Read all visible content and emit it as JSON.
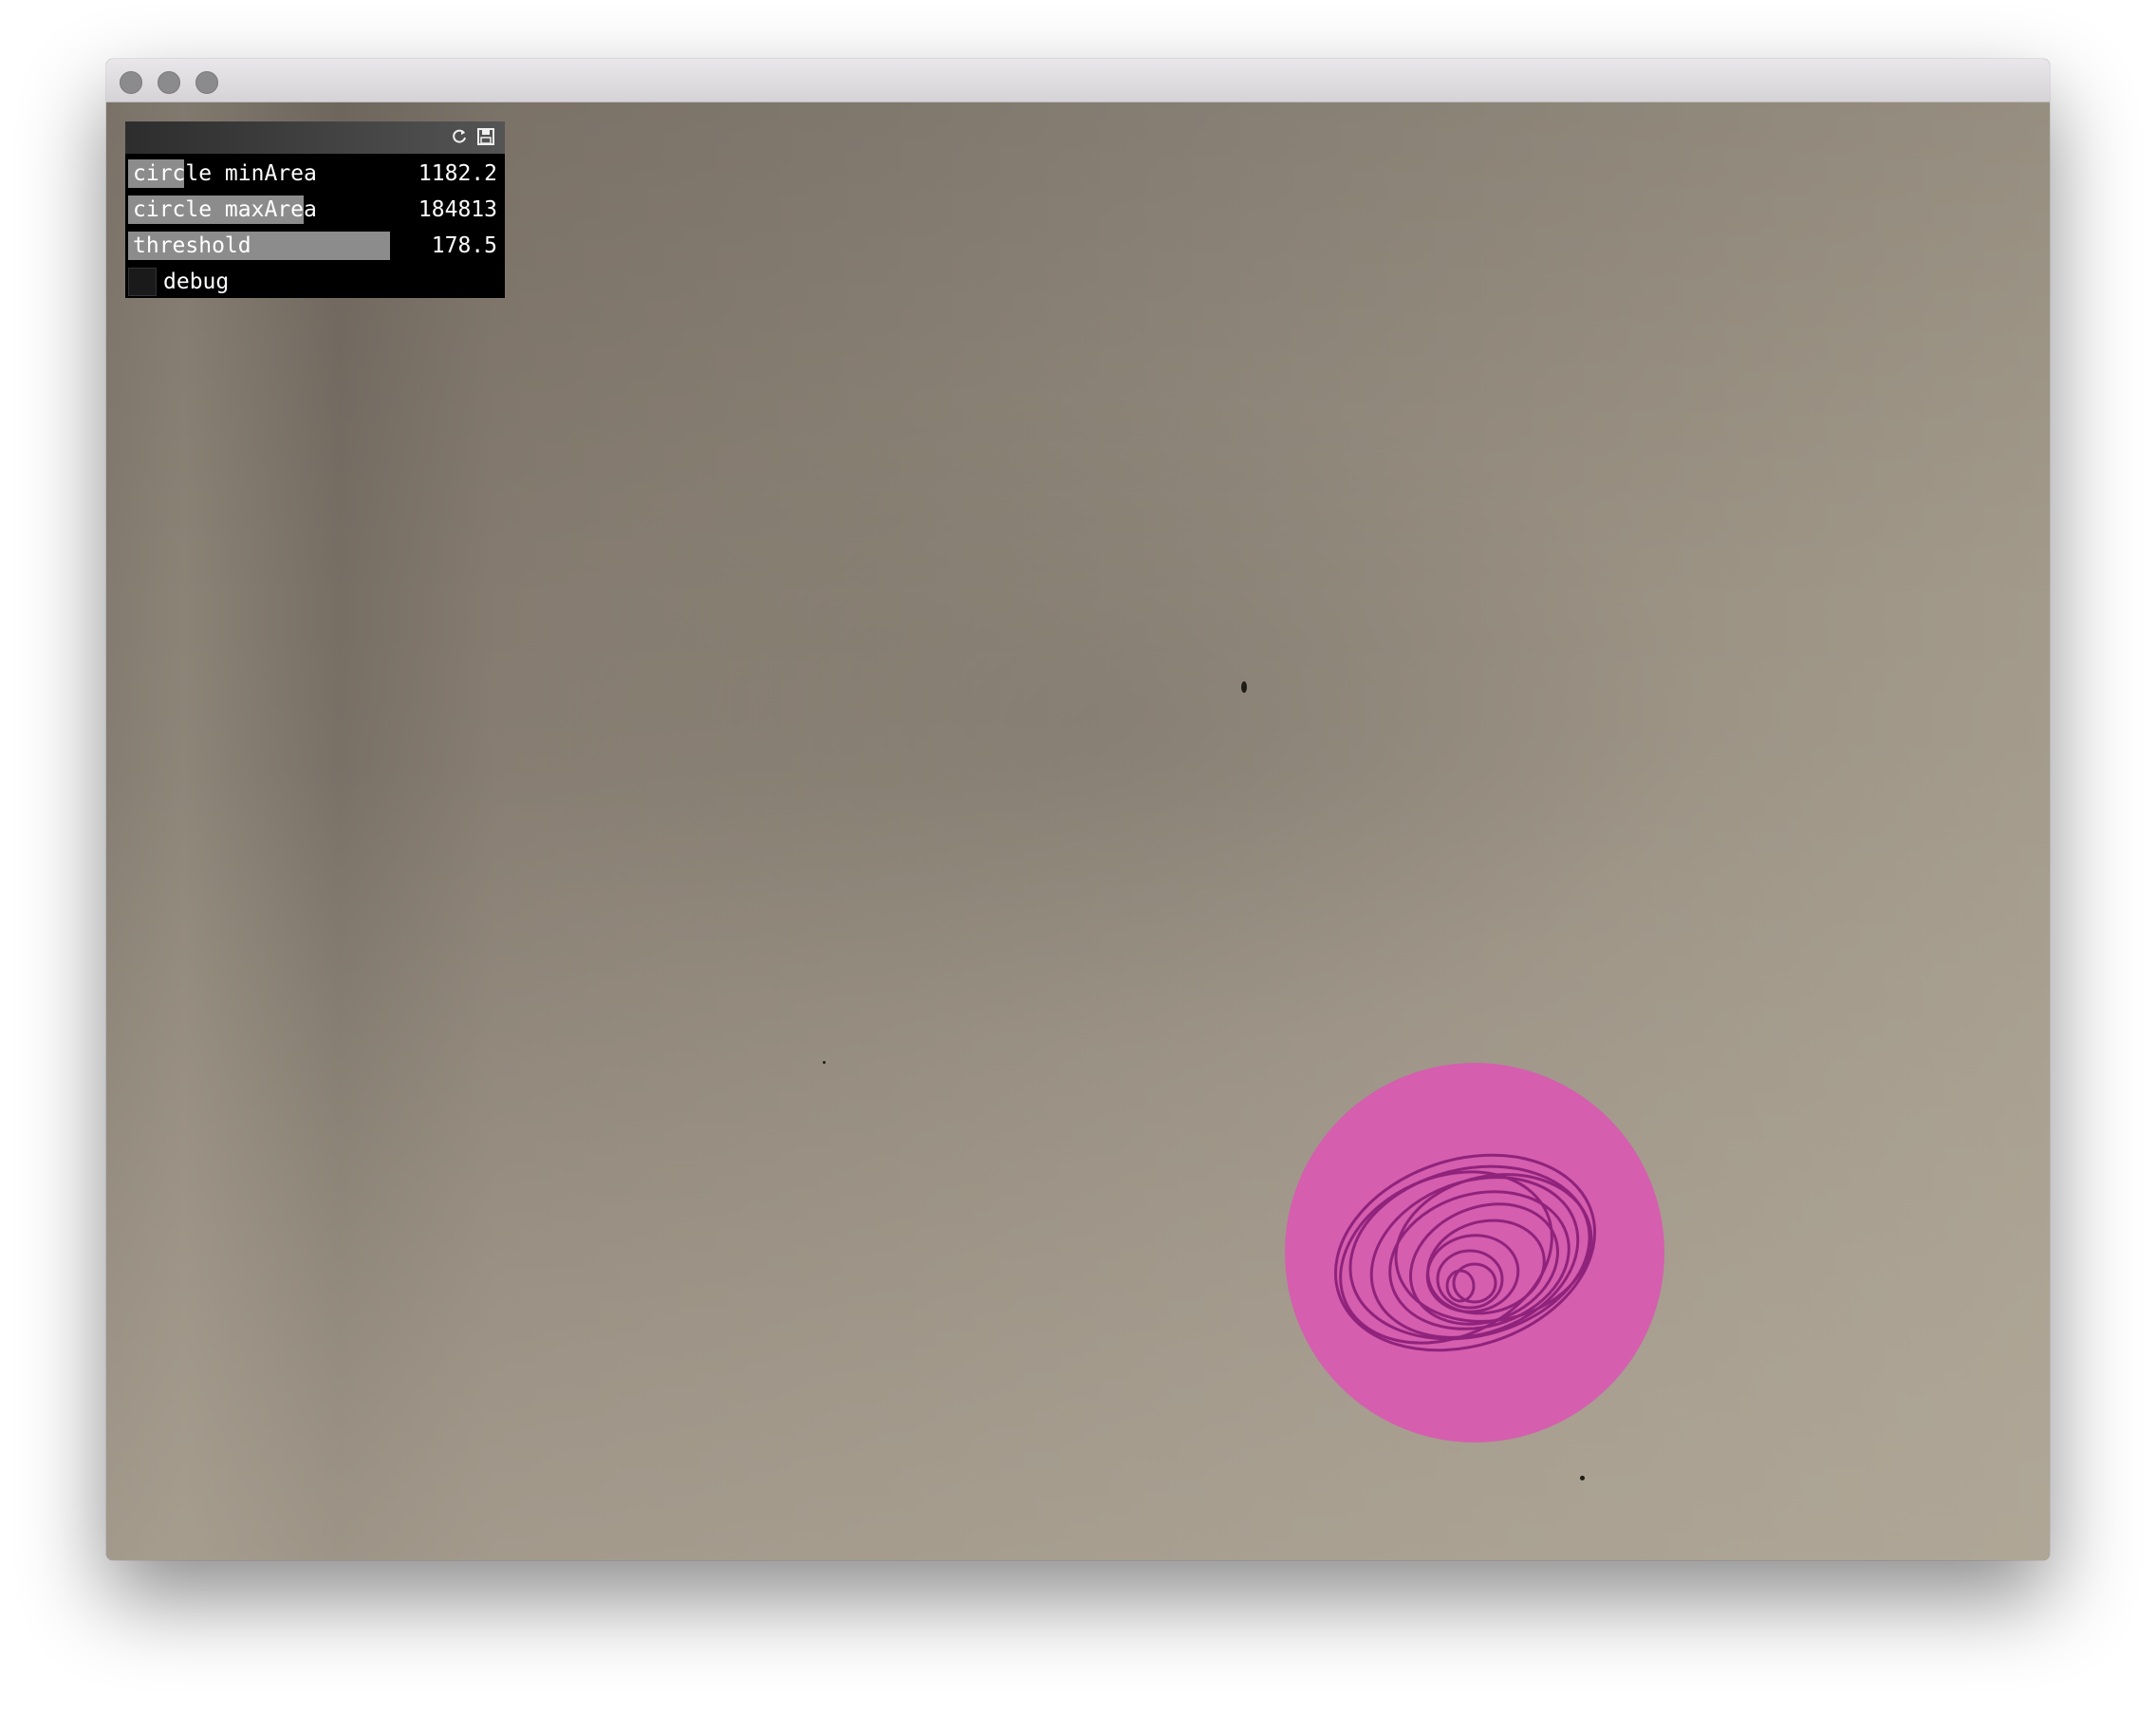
{
  "window": {
    "traffic_lights": [
      "close",
      "minimize",
      "zoom"
    ]
  },
  "gui": {
    "header_icons": [
      "reload-icon",
      "save-icon"
    ],
    "sliders": [
      {
        "label": "circle minArea",
        "value": "1182.2",
        "fraction": 0.15
      },
      {
        "label": "circle maxArea",
        "value": "184813",
        "fraction": 0.47
      },
      {
        "label": "threshold",
        "value": "178.5",
        "fraction": 0.7
      }
    ],
    "toggles": [
      {
        "label": "debug",
        "checked": false
      }
    ]
  },
  "colors": {
    "detected_circle": "#d55eae",
    "scribble": "#8a1f78"
  }
}
